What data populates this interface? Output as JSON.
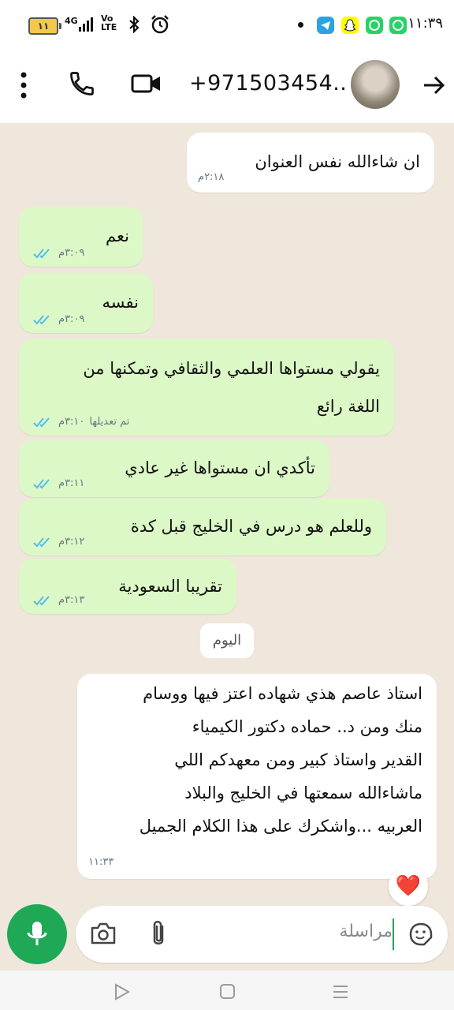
{
  "status_bar": {
    "battery": "١١",
    "network": "4G",
    "volte": "Vo LTE",
    "time": "١١:٣٩"
  },
  "header": {
    "contact_name": "+971503454..",
    "icons": [
      "more-vert-icon",
      "phone-icon",
      "video-icon",
      "back-arrow-icon"
    ]
  },
  "messages": [
    {
      "direction": "in",
      "lines": [
        "ان شاءالله نفس العنوان"
      ],
      "time": "٢:١٨م"
    },
    {
      "direction": "out",
      "lines": [
        "نعم"
      ],
      "time": "٣:٠٩م",
      "read": true
    },
    {
      "direction": "out",
      "lines": [
        "نفسه"
      ],
      "time": "٣:٠٩م",
      "read": true
    },
    {
      "direction": "out",
      "lines": [
        "يقولي مستواها العلمي والثقافي وتمكنها من",
        "اللغة رائع"
      ],
      "edited_label": "تم تعديلها",
      "time": "٣:١٠م",
      "read": true
    },
    {
      "direction": "out",
      "lines": [
        "تأكدي ان مستواها غير عادي"
      ],
      "time": "٣:١١م",
      "read": true
    },
    {
      "direction": "out",
      "lines": [
        "وللعلم هو درس في الخليج قبل كدة"
      ],
      "time": "٣:١٢م",
      "read": true
    },
    {
      "direction": "out",
      "lines": [
        "تقريبا السعودية"
      ],
      "time": "٣:١٣م",
      "read": true
    },
    {
      "direction": "in",
      "lines": [
        "استاذ عاصم هذي شهاده اعتز فيها ووسام",
        "منك ومن د.. حماده دكتور الكيمياء",
        "القدير واستاذ كبير ومن معهدكم اللي",
        "ماشاءالله سمعتها في  الخليج والبلاد",
        "العربيه  ...واشكرك على هذا الكلام الجميل"
      ],
      "time": "١١:٣٣",
      "reaction": "❤️"
    }
  ],
  "date_divider": "اليوم",
  "composer": {
    "placeholder": "مراسلة"
  },
  "colors": {
    "chat_bg": "#efe7dc",
    "outgoing_bubble": "#dcf8c6",
    "incoming_bubble": "#ffffff",
    "accent_green": "#1fa855",
    "read_ticks": "#53bdeb"
  }
}
